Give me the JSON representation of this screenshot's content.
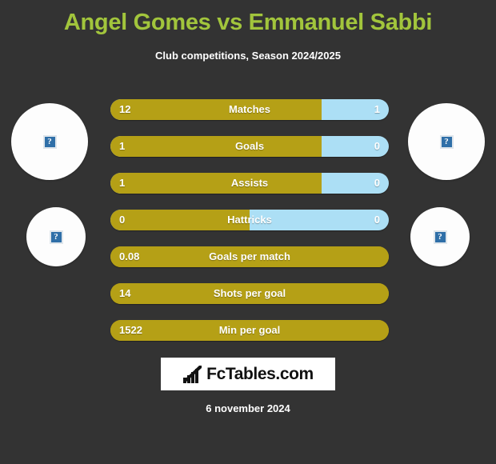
{
  "header": {
    "title": "Angel Gomes vs Emmanuel Sabbi",
    "subtitle": "Club competitions, Season 2024/2025",
    "title_color": "#a2c53c"
  },
  "avatars": {
    "home_player": {
      "name": "home-player-photo",
      "placeholder": "?"
    },
    "home_club": {
      "name": "home-club-logo",
      "placeholder": "?"
    },
    "away_player": {
      "name": "away-player-photo",
      "placeholder": "?"
    },
    "away_club": {
      "name": "away-club-logo",
      "placeholder": "?"
    }
  },
  "footer": {
    "logo_text": "FcTables.com",
    "logo_icon": "bar-chart-growth-icon",
    "date": "6 november 2024"
  },
  "colors": {
    "background": "#333333",
    "home_bar": "#b5a016",
    "away_bar": "#acdff5",
    "accent": "#a2c53c"
  },
  "chart_data": {
    "type": "bar",
    "title": "Angel Gomes vs Emmanuel Sabbi",
    "subtitle": "Club competitions, Season 2024/2025",
    "orientation": "horizontal-diverging",
    "legend": [
      "Angel Gomes",
      "Emmanuel Sabbi"
    ],
    "categories": [
      "Matches",
      "Goals",
      "Assists",
      "Hattricks",
      "Goals per match",
      "Shots per goal",
      "Min per goal"
    ],
    "series": [
      {
        "name": "Angel Gomes",
        "values": [
          "12",
          "1",
          "1",
          "0",
          "0.08",
          "14",
          "1522"
        ]
      },
      {
        "name": "Emmanuel Sabbi",
        "values": [
          "1",
          "0",
          "0",
          "0",
          "",
          "",
          ""
        ]
      }
    ],
    "rows": [
      {
        "label": "Matches",
        "home": "12",
        "away": "1",
        "home_pct": 76,
        "has_away": true
      },
      {
        "label": "Goals",
        "home": "1",
        "away": "0",
        "home_pct": 76,
        "has_away": true
      },
      {
        "label": "Assists",
        "home": "1",
        "away": "0",
        "home_pct": 76,
        "has_away": true
      },
      {
        "label": "Hattricks",
        "home": "0",
        "away": "0",
        "home_pct": 50,
        "has_away": true
      },
      {
        "label": "Goals per match",
        "home": "0.08",
        "away": "",
        "home_pct": 100,
        "has_away": false
      },
      {
        "label": "Shots per goal",
        "home": "14",
        "away": "",
        "home_pct": 100,
        "has_away": false
      },
      {
        "label": "Min per goal",
        "home": "1522",
        "away": "",
        "home_pct": 100,
        "has_away": false
      }
    ]
  }
}
